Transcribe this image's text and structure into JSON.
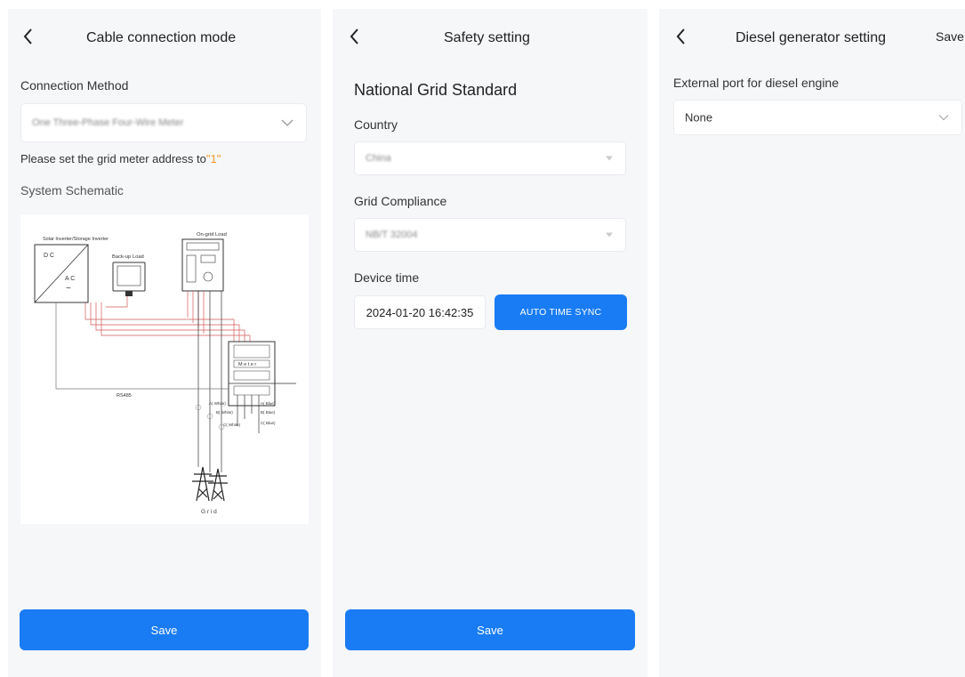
{
  "panel1": {
    "title": "Cable connection mode",
    "connection_method_label": "Connection Method",
    "connection_method_value": "One Three-Phase Four-Wire Meter",
    "note_prefix": "Please set the grid meter address to",
    "note_value": "\"1\"",
    "schematic_label": "System Schematic",
    "schematic": {
      "inverter_label": "Solar Inverter/Storage Inverter",
      "dc_label": "D C",
      "ac_label": "A C",
      "backup_label": "Back-up Load",
      "ongrid_label": "On-grid Load",
      "meter_label": "M e t e r",
      "rs485_label": "RS485",
      "grid_label": "G r i d",
      "ct_labels": [
        "A( White)",
        "B( White)",
        "C( White)"
      ],
      "ct_labels_right": [
        "A( Blue)",
        "B( Blue)",
        "C( Blue)"
      ]
    },
    "save_label": "Save"
  },
  "panel2": {
    "title": "Safety setting",
    "section_title": "National Grid Standard",
    "country_label": "Country",
    "country_value": "China",
    "grid_compliance_label": "Grid Compliance",
    "grid_compliance_value": "NB/T 32004",
    "device_time_label": "Device time",
    "device_time_value": "2024-01-20 16:42:35",
    "sync_label": "AUTO TIME SYNC",
    "save_label": "Save"
  },
  "panel3": {
    "title": "Diesel generator setting",
    "save_label": "Save",
    "port_label": "External port for diesel engine",
    "port_value": "None"
  },
  "colors": {
    "primary": "#1a7cf4",
    "highlight": "#f29b25",
    "panel_bg": "#f6f7f9"
  },
  "icons": [
    "back-arrow-icon",
    "chevron-down-icon",
    "transmission-tower-icon"
  ]
}
